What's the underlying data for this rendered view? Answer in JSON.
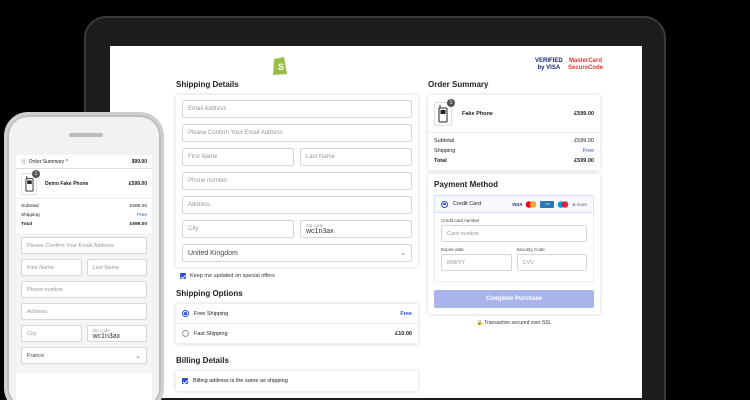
{
  "colors": {
    "accent": "#2b4bd8",
    "button": "#aab4ec"
  },
  "badges": {
    "visa_top": "VERIFIED",
    "visa_bottom": "by VISA",
    "mc_top": "MasterCard",
    "mc_bottom": "SecureCode"
  },
  "shipping_details": {
    "title": "Shipping Details",
    "email_placeholder": "Email Address",
    "confirm_email_placeholder": "Please Confirm Your Email Address",
    "first_name_placeholder": "First Name",
    "last_name_placeholder": "Last Name",
    "phone_placeholder": "Phone number",
    "address_placeholder": "Address",
    "city_placeholder": "City",
    "zip_label": "Zip code",
    "zip_value": "wc1n3ax",
    "country": "United Kingdom",
    "updates_label": "Keep me updated on special offers"
  },
  "shipping_options": {
    "title": "Shipping Options",
    "items": [
      {
        "label": "Free Shipping",
        "price": "Free"
      },
      {
        "label": "Fast Shipping",
        "price": "£10.00"
      }
    ]
  },
  "billing": {
    "title": "Billing Details",
    "same_label": "Billing address is the same as shipping"
  },
  "order_summary": {
    "title": "Order Summary",
    "product_name": "Fake Phone",
    "product_price": "£599.00",
    "qty": "1",
    "subtotal_label": "Subtotal",
    "subtotal": "£599.00",
    "shipping_label": "Shipping",
    "shipping": "Free",
    "total_label": "Total",
    "total": "£599.00"
  },
  "payment": {
    "title": "Payment Method",
    "option": "Credit Card",
    "brands": [
      "VISA",
      "MC",
      "AMEX",
      "MC"
    ],
    "more": "& more",
    "card_number_label": "Credit card number",
    "card_number_placeholder": "Card number",
    "expiry_label": "Expire date",
    "expiry_placeholder": "MM/YY",
    "cvv_label": "Security Code",
    "cvv_placeholder": "CVV",
    "button": "Complete Purchase",
    "secure_text": "Transaction secured over SSL"
  },
  "mobile": {
    "summary_label": "Order Summary",
    "summary_price": "$99.00",
    "product_name": "Demo Fake Phone",
    "product_price": "£599.00",
    "qty": "1",
    "subtotal_label": "Subtotal",
    "subtotal": "£599.00",
    "shipping_label": "Shipping",
    "shipping": "Free",
    "total_label": "Total",
    "total": "£599.00",
    "confirm_email_placeholder": "Please Confirm Your Email Address",
    "first_name_placeholder": "First Name",
    "last_name_placeholder": "Last Name",
    "phone_placeholder": "Phone number",
    "address_placeholder": "Address",
    "city_placeholder": "City",
    "zip_label": "Zip code",
    "zip_value": "wc1n3ax",
    "country": "France"
  }
}
